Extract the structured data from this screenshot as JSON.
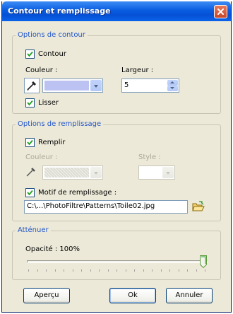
{
  "window": {
    "title": "Contour et remplissage"
  },
  "contour_group": {
    "title": "Options de contour",
    "contour_check": {
      "label": "Contour",
      "checked": true
    },
    "color_label": "Couleur :",
    "color_value": "#bcc3f2",
    "width_label": "Largeur :",
    "width_value": "5",
    "smooth_check": {
      "label": "Lisser",
      "checked": true
    }
  },
  "fill_group": {
    "title": "Options de remplissage",
    "fill_check": {
      "label": "Remplir",
      "checked": true
    },
    "color_label": "Couleur :",
    "style_label": "Style :",
    "pattern_check": {
      "label": "Motif de remplissage :",
      "checked": true
    },
    "pattern_path": "C:\\...\\PhotoFiltre\\Patterns\\Toile02.jpg"
  },
  "fade_group": {
    "title": "Atténuer",
    "opacity_label": "Opacité : 100%",
    "opacity_value": 100
  },
  "buttons": {
    "preview": "Aperçu",
    "ok": "Ok",
    "cancel": "Annuler"
  },
  "icons": {
    "close": "close-icon",
    "dropper": "eyedropper-icon",
    "folder": "open-folder-icon",
    "check": "checkmark-icon"
  }
}
